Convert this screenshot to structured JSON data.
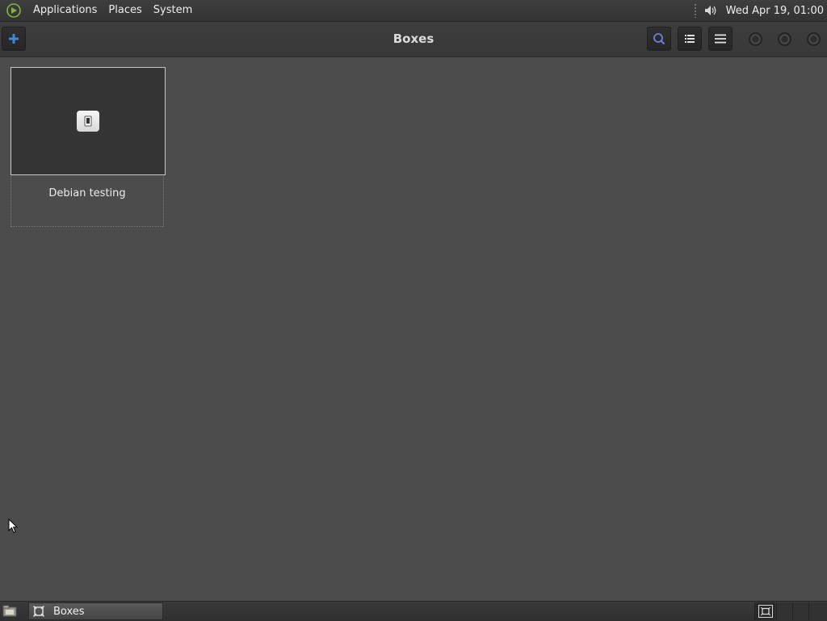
{
  "top_panel": {
    "menus": [
      "Applications",
      "Places",
      "System"
    ],
    "clock": "Wed Apr 19, 01:00"
  },
  "headerbar": {
    "title": "Boxes"
  },
  "boxes": [
    {
      "name": "Debian testing"
    }
  ],
  "taskbar": {
    "tasks": [
      {
        "label": "Boxes"
      }
    ]
  },
  "colors": {
    "accent_blue": "#3d86d9",
    "background": "#4c4c4c",
    "thumbnail": "#353535"
  }
}
